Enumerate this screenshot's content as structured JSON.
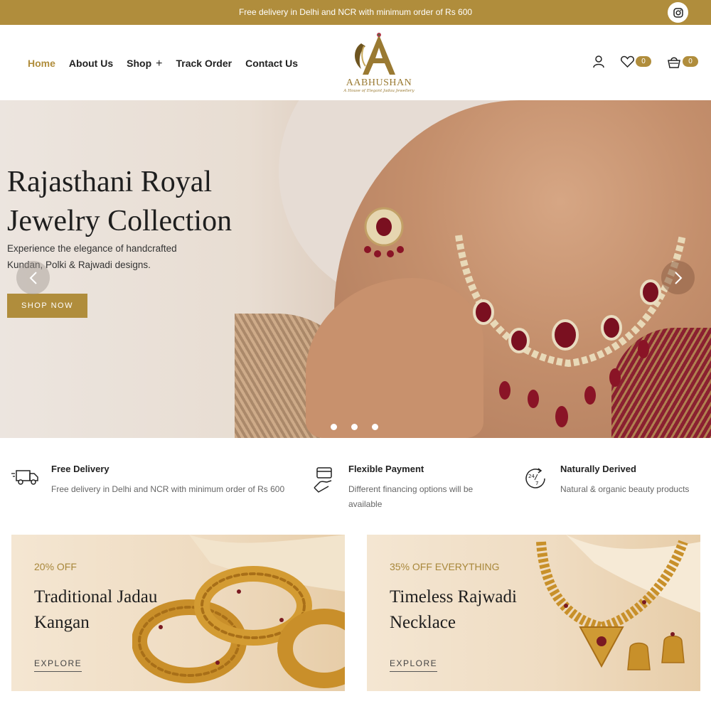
{
  "topbar": {
    "message": "Free delivery in Delhi and NCR with minimum order of Rs 600"
  },
  "nav": {
    "items": [
      "Home",
      "About Us",
      "Shop",
      "Track Order",
      "Contact Us"
    ]
  },
  "logo": {
    "brand": "AABHUSHAN",
    "tagline": "A House of Elegant Jadau Jewellery"
  },
  "header": {
    "wishlist_count": "0",
    "cart_count": "0"
  },
  "hero": {
    "title_line1": "Rajasthani Royal",
    "title_line2": "Jewelry Collection",
    "subtitle_line1": "Experience the elegance of handcrafted",
    "subtitle_line2": "Kundan, Polki & Rajwadi designs.",
    "cta": "SHOP NOW",
    "slide_count": 3,
    "active_slide": 1
  },
  "features": [
    {
      "title": "Free Delivery",
      "desc": "Free delivery in Delhi and NCR with minimum order of Rs 600",
      "icon": "truck-icon"
    },
    {
      "title": "Flexible Payment",
      "desc_line1": "Different financing options will be",
      "desc_line2": "available",
      "icon": "card-hand-icon"
    },
    {
      "title": "Naturally Derived",
      "desc": "Natural & organic beauty products",
      "icon": "clock-24-7-icon"
    }
  ],
  "promos": [
    {
      "discount": "20% OFF",
      "title_line1": "Traditional Jadau",
      "title_line2": "Kangan",
      "cta": "EXPLORE"
    },
    {
      "discount": "35% OFF EVERYTHING",
      "title_line1": "Timeless Rajwadi",
      "title_line2": "Necklace",
      "cta": "EXPLORE"
    }
  ],
  "colors": {
    "accent": "#b08d3c",
    "text": "#222222"
  }
}
